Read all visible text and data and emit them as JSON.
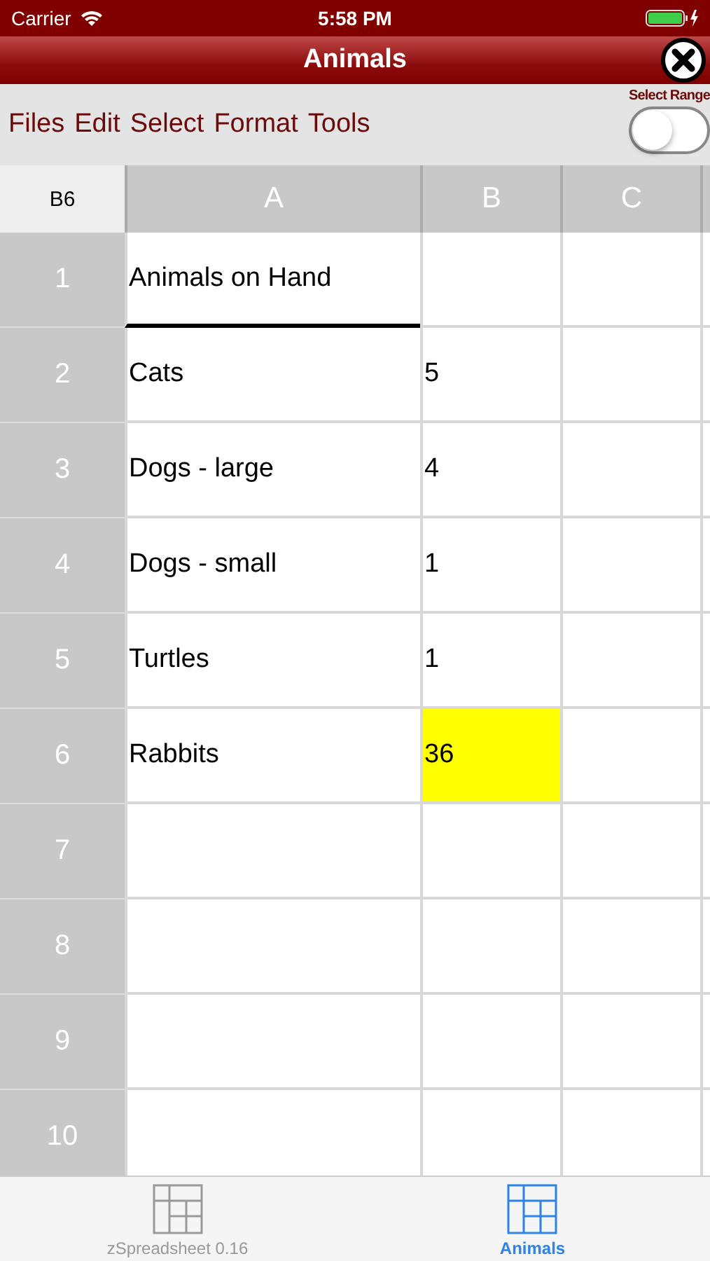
{
  "status_bar": {
    "carrier": "Carrier",
    "time": "5:58 PM"
  },
  "title_bar": {
    "title": "Animals"
  },
  "toolbar": {
    "menus": [
      "Files",
      "Edit",
      "Select",
      "Format",
      "Tools"
    ],
    "toggle": {
      "label": "Select Range",
      "on": false
    }
  },
  "sheet": {
    "active_cell": "B6",
    "columns": [
      "A",
      "B",
      "C"
    ],
    "rows": [
      {
        "label": "1",
        "cells": [
          {
            "text": "Animals on Hand",
            "underline": true
          },
          {},
          {}
        ]
      },
      {
        "label": "2",
        "cells": [
          {
            "text": "Cats"
          },
          {
            "text": "5"
          },
          {}
        ]
      },
      {
        "label": "3",
        "cells": [
          {
            "text": "Dogs - large"
          },
          {
            "text": "4"
          },
          {}
        ]
      },
      {
        "label": "4",
        "cells": [
          {
            "text": "Dogs - small"
          },
          {
            "text": "1"
          },
          {}
        ]
      },
      {
        "label": "5",
        "cells": [
          {
            "text": "Turtles"
          },
          {
            "text": "1"
          },
          {}
        ]
      },
      {
        "label": "6",
        "cells": [
          {
            "text": "Rabbits"
          },
          {
            "text": "36",
            "color": "#ffff00"
          },
          {}
        ]
      },
      {
        "label": "7",
        "cells": [
          {},
          {},
          {}
        ]
      },
      {
        "label": "8",
        "cells": [
          {},
          {},
          {}
        ]
      },
      {
        "label": "9",
        "cells": [
          {},
          {},
          {}
        ]
      },
      {
        "label": "10",
        "cells": [
          {},
          {},
          {}
        ]
      }
    ]
  },
  "tab_bar": [
    {
      "label": "zSpreadsheet 0.16",
      "selected": false
    },
    {
      "label": "Animals",
      "selected": true
    }
  ]
}
